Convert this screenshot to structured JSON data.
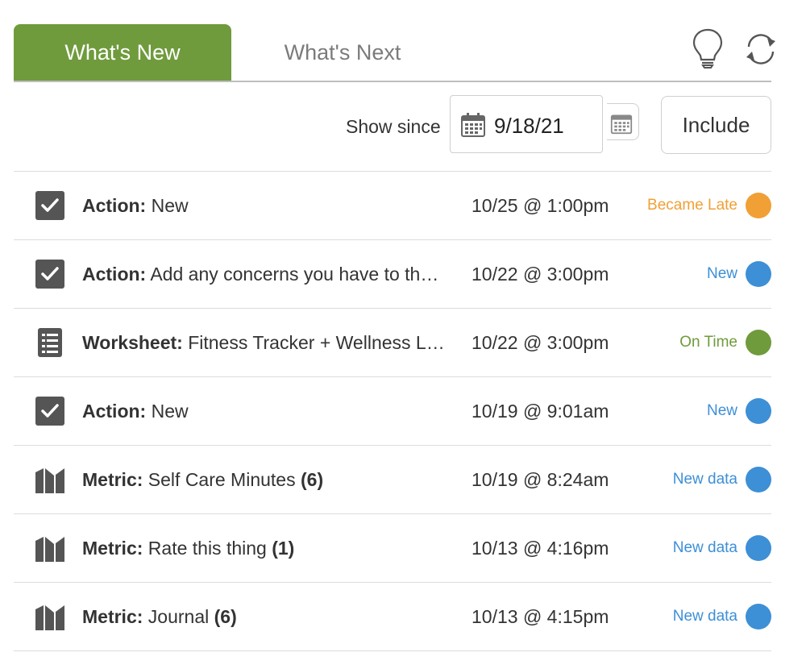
{
  "tabs": {
    "active_label": "What's New",
    "inactive_label": "What's Next"
  },
  "toolbar": {
    "idea_icon": "lightbulb-icon",
    "refresh_icon": "refresh-icon"
  },
  "filter": {
    "label": "Show since",
    "date_value": "9/18/21",
    "calendar_icon": "calendar-icon",
    "include_label": "Include"
  },
  "colors": {
    "accent_green": "#6f9b3c",
    "late_orange": "#f0a035",
    "new_blue": "#3d8fd6",
    "on_time_green": "#6f9b3c",
    "icon_gray": "#555555"
  },
  "items": [
    {
      "icon": "checkbox-icon",
      "type": "Action:",
      "text": " New",
      "count": "",
      "time": "10/25 @ 1:00pm",
      "status": "Became Late",
      "status_color": "#f0a035"
    },
    {
      "icon": "checkbox-icon",
      "type": "Action:",
      "text": " Add any concerns you have to the list",
      "count": "",
      "time": "10/22 @ 3:00pm",
      "status": "New",
      "status_color": "#3d8fd6"
    },
    {
      "icon": "worksheet-icon",
      "type": "Worksheet:",
      "text": " Fitness Tracker + Wellness Log",
      "count": "",
      "time": "10/22 @ 3:00pm",
      "status": "On Time",
      "status_color": "#6f9b3c"
    },
    {
      "icon": "checkbox-icon",
      "type": "Action:",
      "text": " New",
      "count": "",
      "time": "10/19 @ 9:01am",
      "status": "New",
      "status_color": "#3d8fd6"
    },
    {
      "icon": "metric-icon",
      "type": "Metric:",
      "text": " Self Care Minutes ",
      "count": "(6)",
      "time": "10/19 @ 8:24am",
      "status": "New data",
      "status_color": "#3d8fd6"
    },
    {
      "icon": "metric-icon",
      "type": "Metric:",
      "text": " Rate this thing ",
      "count": "(1)",
      "time": "10/13 @ 4:16pm",
      "status": "New data",
      "status_color": "#3d8fd6"
    },
    {
      "icon": "metric-icon",
      "type": "Metric:",
      "text": " Journal ",
      "count": "(6)",
      "time": "10/13 @ 4:15pm",
      "status": "New data",
      "status_color": "#3d8fd6"
    }
  ]
}
